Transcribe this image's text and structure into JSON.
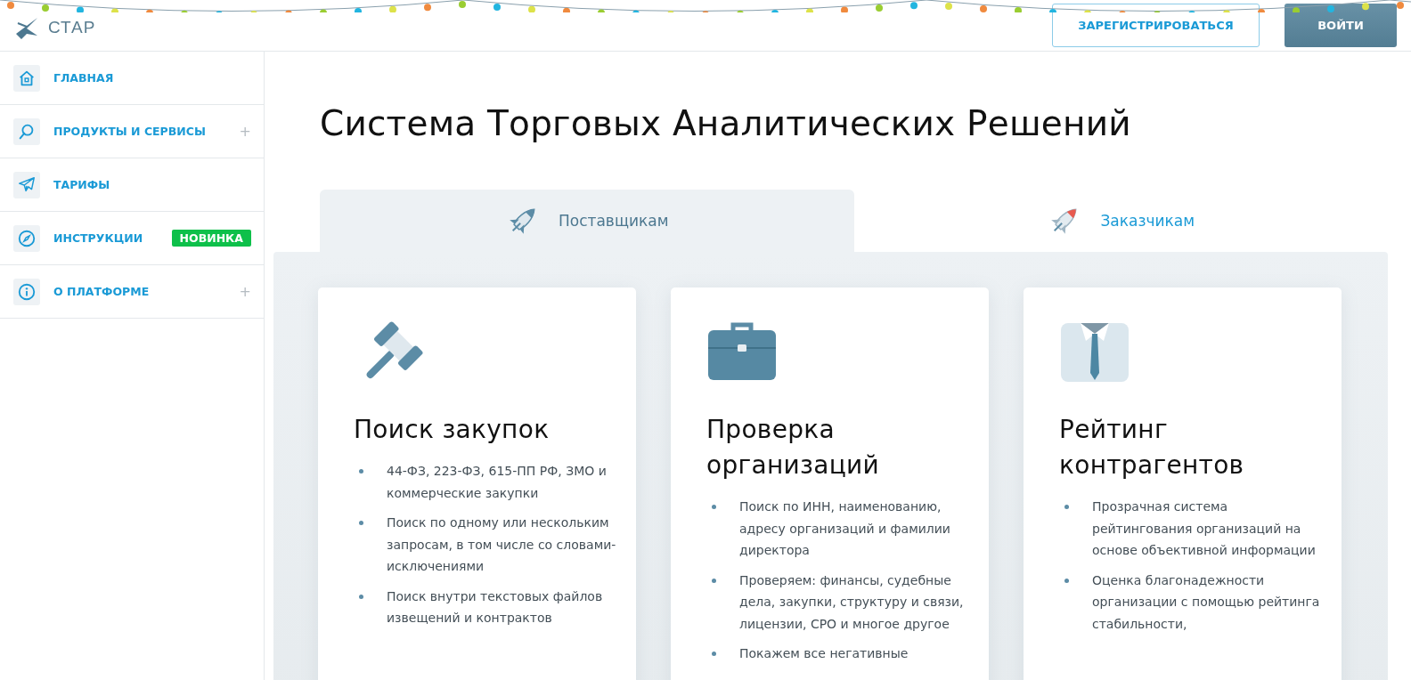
{
  "header": {
    "logo_text": "СТАР",
    "buttons": [
      {
        "label": "ЗАРЕГИСТРИРОВАТЬСЯ",
        "kind": "outline"
      },
      {
        "label": "ВОЙТИ",
        "kind": "primary"
      }
    ]
  },
  "sidebar": {
    "items": [
      {
        "label": "ГЛАВНАЯ",
        "kind": "home"
      },
      {
        "label": "ПРОДУКТЫ И СЕРВИСЫ",
        "kind": "search",
        "toggle": "+"
      },
      {
        "label": "ТАРИФЫ",
        "kind": "plane"
      },
      {
        "label": "ИНСТРУКЦИИ",
        "kind": "compass",
        "badge": "НОВИНКА"
      },
      {
        "label": "О ПЛАТФОРМЕ",
        "kind": "info",
        "toggle": "+"
      }
    ]
  },
  "page_title": "Система Торговых Аналитических Решений",
  "tabs": [
    {
      "label": "Поставщикам",
      "selected": true,
      "kind": "rocket"
    },
    {
      "label": "Заказчикам",
      "selected": false,
      "kind": "rocket-red"
    }
  ],
  "cards": [
    {
      "title": "Поиск закупок",
      "kind": "gavel",
      "bullets": [
        "44-ФЗ, 223-ФЗ, 615-ПП РФ, ЗМО и коммерческие закупки",
        "Поиск по одному или нескольким запросам, в том числе со словами-исключениями",
        "Поиск внутри текстовых файлов извещений и контрактов"
      ]
    },
    {
      "title": "Проверка организаций",
      "kind": "briefcase",
      "bullets": [
        "Поиск по ИНН, наименованию, адресу организаций и фамилии директора",
        "Проверяем: финансы, судебные дела, закупки, структуру и связи, лицензии, СРО и многое другое",
        "Покажем все негативные"
      ]
    },
    {
      "title": "Рейтинг контрагентов",
      "kind": "shirt",
      "bullets": [
        "Прозрачная система рейтингования организаций на основе объективной информации",
        "Оценка благонадежности организации с помощью рейтинга стабильности,"
      ]
    }
  ]
}
